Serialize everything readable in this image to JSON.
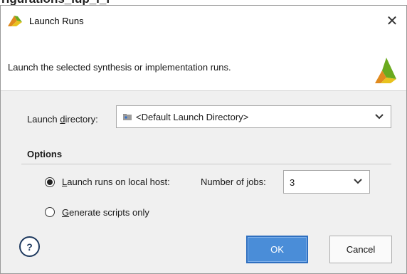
{
  "background_fragment": {
    "text": "rigurations_iup_i_i"
  },
  "window": {
    "title": "Launch Runs",
    "close_glyph": "✕"
  },
  "header": {
    "description": "Launch the selected synthesis or implementation runs."
  },
  "launch_directory": {
    "label_pre": "Launch ",
    "label_mnemonic": "d",
    "label_post": "irectory:",
    "value": "<Default Launch Directory>"
  },
  "options": {
    "title": "Options",
    "local_host": {
      "mnemonic": "L",
      "label_rest": "aunch runs on local host:",
      "selected": true
    },
    "jobs": {
      "label_pre": "Number of ",
      "label_mnemonic": "j",
      "label_post": "obs:",
      "value": "3"
    },
    "scripts_only": {
      "mnemonic": "G",
      "label_rest": "enerate scripts only",
      "selected": false
    }
  },
  "buttons": {
    "help": "?",
    "ok": "OK",
    "cancel": "Cancel"
  },
  "colors": {
    "logo_green": "#6aaa1e",
    "logo_orange": "#e08a1e",
    "ok_blue": "#4a8dd8"
  }
}
